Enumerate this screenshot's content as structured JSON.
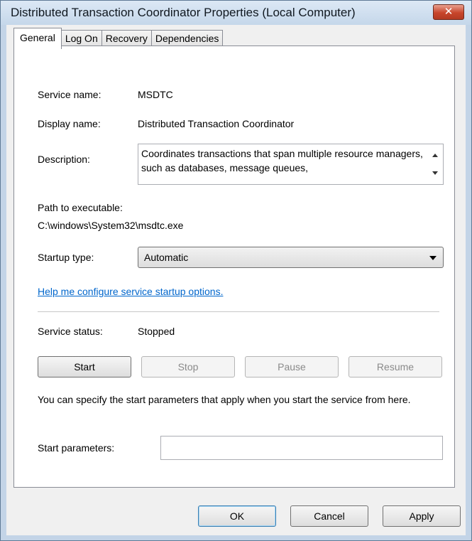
{
  "window": {
    "title": "Distributed Transaction Coordinator Properties (Local Computer)",
    "close_glyph": "✕"
  },
  "tabs": [
    {
      "label": "General",
      "active": true
    },
    {
      "label": "Log On",
      "active": false
    },
    {
      "label": "Recovery",
      "active": false
    },
    {
      "label": "Dependencies",
      "active": false
    }
  ],
  "general": {
    "service_name_label": "Service name:",
    "service_name_value": "MSDTC",
    "display_name_label": "Display name:",
    "display_name_value": "Distributed Transaction Coordinator",
    "description_label": "Description:",
    "description_value": "Coordinates transactions that span multiple resource managers, such as databases, message queues,",
    "path_label": "Path to executable:",
    "path_value": "C:\\windows\\System32\\msdtc.exe",
    "startup_type_label": "Startup type:",
    "startup_type_value": "Automatic",
    "help_link": "Help me configure service startup options.",
    "service_status_label": "Service status:",
    "service_status_value": "Stopped",
    "buttons": {
      "start": "Start",
      "stop": "Stop",
      "pause": "Pause",
      "resume": "Resume"
    },
    "hint_text": "You can specify the start parameters that apply when you start the service from here.",
    "start_parameters_label": "Start parameters:",
    "start_parameters_value": ""
  },
  "dialog_buttons": {
    "ok": "OK",
    "cancel": "Cancel",
    "apply": "Apply"
  },
  "colors": {
    "link": "#0066cc",
    "close_button": "#c8462c",
    "disabled_text": "#8a8a8a"
  }
}
